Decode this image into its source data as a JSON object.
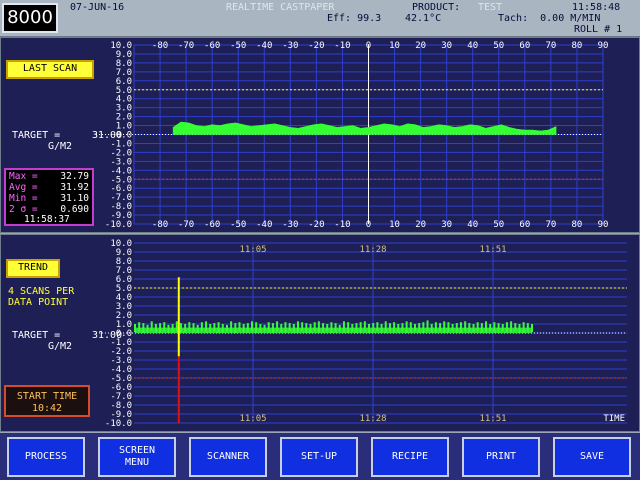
{
  "header": {
    "logo": "8000",
    "date": "07-JUN-16",
    "title": "REALTIME CASTPAPER",
    "product_label": "PRODUCT:",
    "product_value": "TEST",
    "time": "11:58:48",
    "eff": "Eff: 99.3",
    "temperature": "42.1°C",
    "tach": "Tach:  0.00 M/MIN",
    "roll": "ROLL # 1"
  },
  "scan_panel": {
    "button": "LAST SCAN",
    "target_label": "TARGET =",
    "target_value": "31.00",
    "units": "G/M2",
    "stats": [
      {
        "label": "Max =",
        "value": "32.79"
      },
      {
        "label": "Avg =",
        "value": "31.92"
      },
      {
        "label": "Min =",
        "value": "31.10"
      },
      {
        "label": "2 σ =",
        "value": "0.690"
      }
    ],
    "stats_time": "11:58:37",
    "x_ticks": [
      "-80",
      "-70",
      "-60",
      "-50",
      "-40",
      "-30",
      "-20",
      "-10",
      "0",
      "10",
      "20",
      "30",
      "40",
      "50",
      "60",
      "70",
      "80",
      "90"
    ],
    "y_ticks": [
      "10.0",
      "9.0",
      "8.0",
      "7.0",
      "6.0",
      "5.0",
      "4.0",
      "3.0",
      "2.0",
      "1.0",
      "0.0",
      "-1.0",
      "-2.0",
      "-3.0",
      "-4.0",
      "-5.0",
      "-6.0",
      "-7.0",
      "-8.0",
      "-9.0",
      "-10.0"
    ]
  },
  "trend_panel": {
    "button": "TREND",
    "scans_note_1": "4 SCANS PER",
    "scans_note_2": "DATA POINT",
    "target_label": "TARGET =",
    "target_value": "31.00",
    "units": "G/M2",
    "start_time_label": "START TIME",
    "start_time_value": "10:42",
    "time_ticks": [
      "11:05",
      "11:28",
      "11:51"
    ],
    "x_axis_label": "TIME",
    "y_ticks": [
      "10.0",
      "9.0",
      "8.0",
      "7.0",
      "6.0",
      "5.0",
      "4.0",
      "3.0",
      "2.0",
      "1.0",
      "0.0",
      "-1.0",
      "-2.0",
      "-3.0",
      "-4.0",
      "-5.0",
      "-6.0",
      "-7.0",
      "-8.0",
      "-9.0",
      "-10.0"
    ]
  },
  "buttons": [
    "PROCESS",
    "SCREEN\nMENU",
    "SCANNER",
    "SET-UP",
    "RECIPE",
    "PRINT",
    "SAVE"
  ],
  "colors": {
    "plot_bg": "#1e1f55",
    "grid": "#2f3fcf",
    "profile_fill": "#33ff33",
    "limit_line": "#ffff00",
    "low_limit_line": "#cc3b1e",
    "tick_labels": "#ffffff",
    "time_labels": "#d4c07a"
  },
  "chart_data": [
    {
      "type": "area",
      "title": "LAST SCAN",
      "xlim": [
        -90,
        90
      ],
      "ylim": [
        -10,
        10
      ],
      "ylabel": "G/M2",
      "grid": true,
      "x": [
        -75,
        -72,
        -69,
        -66,
        -63,
        -60,
        -57,
        -54,
        -51,
        -48,
        -45,
        -42,
        -39,
        -36,
        -33,
        -30,
        -27,
        -24,
        -21,
        -18,
        -15,
        -12,
        -9,
        -6,
        -3,
        0,
        3,
        6,
        9,
        12,
        15,
        18,
        21,
        24,
        27,
        30,
        33,
        36,
        39,
        42,
        45,
        48,
        51,
        54,
        57,
        60,
        63,
        66,
        69,
        72
      ],
      "values": [
        0.8,
        1.4,
        1.3,
        1.0,
        0.9,
        1.1,
        1.0,
        1.2,
        1.3,
        1.1,
        0.9,
        1.0,
        1.1,
        1.2,
        1.0,
        0.8,
        0.7,
        0.9,
        1.1,
        1.2,
        1.0,
        0.8,
        0.9,
        1.0,
        0.7,
        0.8,
        1.0,
        1.2,
        1.1,
        0.9,
        1.2,
        1.1,
        0.8,
        0.9,
        1.1,
        1.0,
        0.8,
        0.9,
        1.1,
        1.0,
        0.7,
        0.9,
        1.1,
        0.8,
        0.6,
        0.5,
        0.5,
        0.4,
        0.5,
        0.9
      ]
    },
    {
      "type": "bar",
      "title": "TREND",
      "ylim": [
        -10,
        10
      ],
      "x_ticks": [
        "11:05",
        "11:28",
        "11:51"
      ],
      "xlabel": "TIME",
      "ylabel": "G/M2",
      "grid": true,
      "values": [
        1.0,
        1.2,
        1.1,
        0.9,
        1.3,
        1.0,
        1.1,
        1.2,
        0.9,
        1.0,
        1.3,
        1.1,
        1.0,
        1.2,
        1.1,
        0.9,
        1.2,
        1.3,
        1.0,
        1.1,
        1.2,
        1.0,
        0.9,
        1.3,
        1.1,
        1.2,
        1.0,
        1.1,
        1.3,
        1.2,
        1.0,
        0.9,
        1.2,
        1.1,
        1.3,
        1.0,
        1.2,
        1.1,
        1.0,
        1.3,
        1.2,
        1.1,
        1.0,
        1.2,
        1.3,
        1.1,
        1.0,
        1.2,
        1.1,
        0.9,
        1.3,
        1.2,
        1.0,
        1.1,
        1.2,
        1.3,
        1.0,
        1.1,
        1.2,
        1.0,
        1.3,
        1.1,
        1.2,
        1.0,
        1.1,
        1.3,
        1.2,
        1.0,
        1.1,
        1.2,
        1.4,
        1.0,
        1.2,
        1.1,
        1.3,
        1.2,
        1.0,
        1.1,
        1.2,
        1.3,
        1.1,
        1.0,
        1.2,
        1.1,
        1.3,
        1.0,
        1.2,
        1.1,
        1.0,
        1.2,
        1.3,
        1.1,
        1.0,
        1.2,
        1.1,
        1.0
      ],
      "min_values": [
        0.1,
        0.2,
        0.0,
        0.1,
        0.2,
        0.1,
        0.0,
        0.2,
        0.1,
        0.1,
        0.2,
        0.0,
        0.1,
        0.2,
        0.1,
        0.0,
        0.2,
        0.1,
        0.1,
        0.2,
        0.0,
        0.1,
        0.2,
        0.1,
        0.0,
        0.2,
        0.1,
        0.1,
        0.2,
        0.0,
        0.1,
        0.2,
        0.1,
        0.0,
        0.2,
        0.1,
        0.1,
        0.2,
        0.0,
        0.1,
        0.2,
        0.1,
        0.0,
        0.2,
        0.1,
        0.1,
        0.2,
        0.0,
        0.1,
        0.2,
        0.1,
        0.0,
        0.2,
        0.1,
        0.1,
        0.2,
        0.0,
        0.1,
        0.2,
        0.1,
        0.0,
        0.2,
        0.1,
        0.1,
        0.2,
        0.0,
        0.1,
        0.2,
        0.1,
        0.0,
        0.2,
        0.1,
        0.1,
        0.2,
        0.0,
        0.1,
        0.2,
        0.1,
        0.0,
        0.2,
        0.1,
        0.1,
        0.2,
        0.0,
        0.1,
        0.2,
        0.1,
        0.0,
        0.2,
        0.1,
        0.1,
        0.2,
        0.0,
        0.1,
        0.2,
        0.1
      ],
      "marker": {
        "index": 10,
        "high": 6.2,
        "low": -10.0
      }
    }
  ]
}
